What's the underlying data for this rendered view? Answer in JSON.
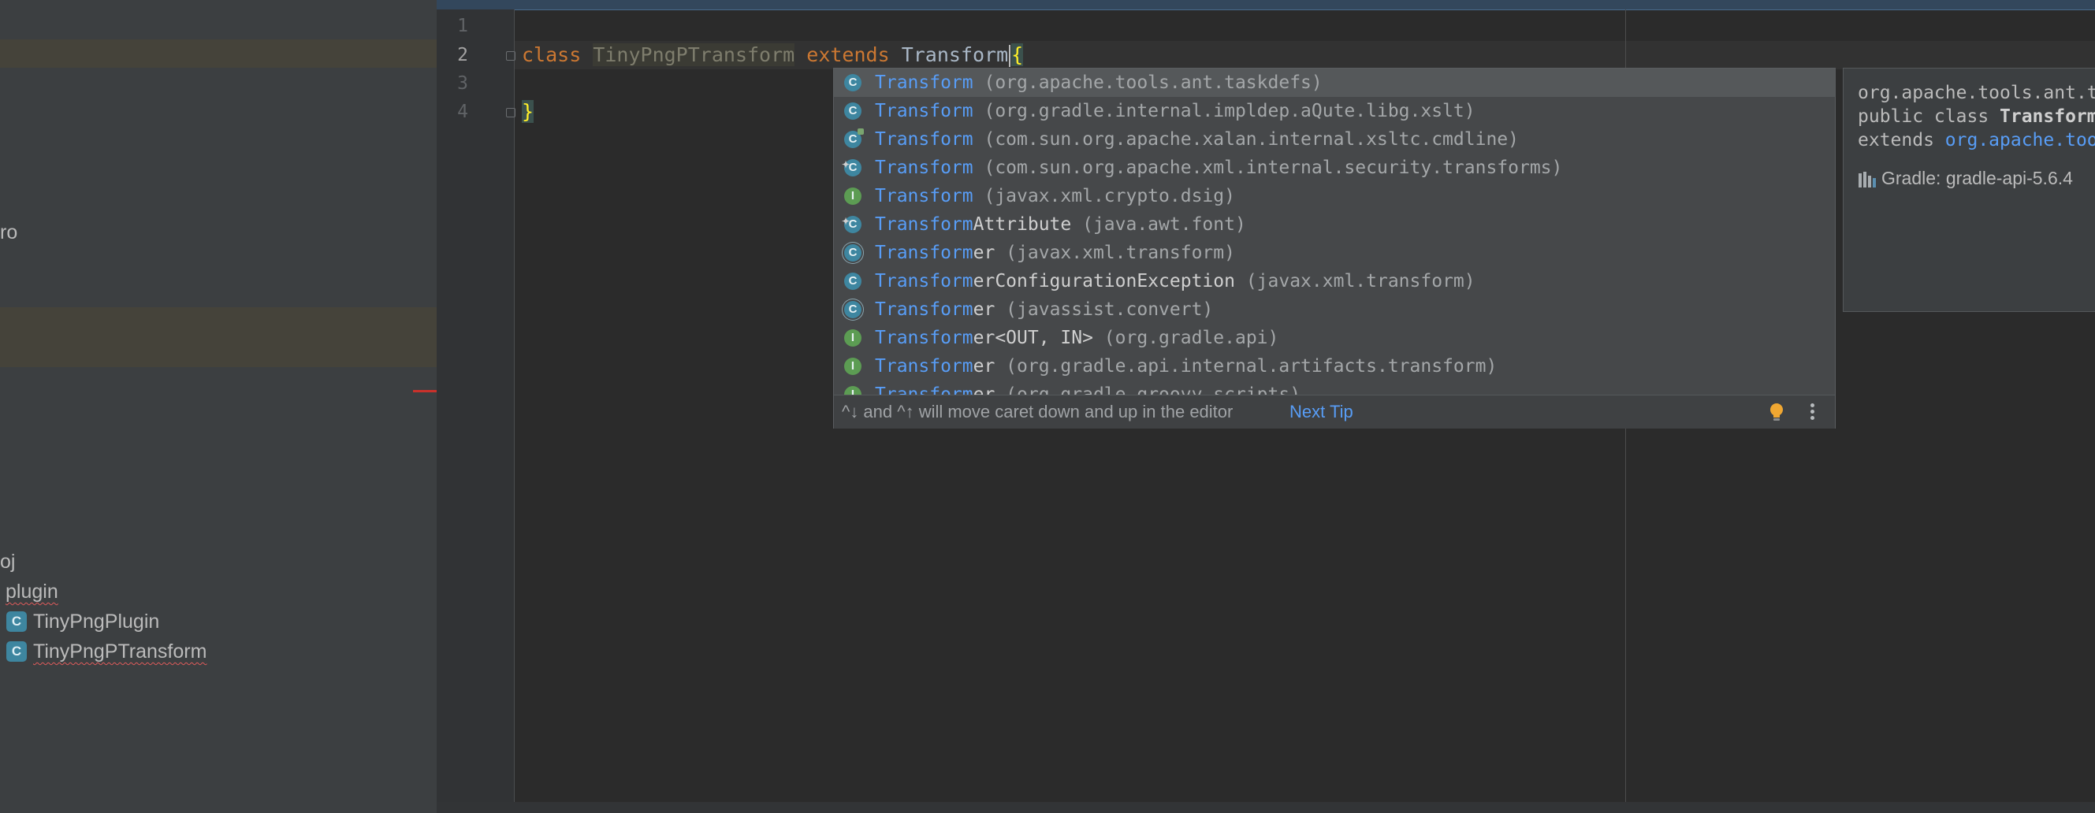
{
  "project_tree": {
    "partial_item_1": "ro",
    "partial_item_2": "oj",
    "folder_label": "plugin",
    "files": [
      {
        "badge": "C",
        "name": "TinyPngPlugin"
      },
      {
        "badge": "C",
        "name": "TinyPngPTransform"
      }
    ]
  },
  "editor": {
    "line_numbers": [
      "1",
      "2",
      "3",
      "4"
    ],
    "current_line": "2",
    "code": {
      "kw_class": "class",
      "class_name": "TinyPngPTransform",
      "kw_extends": "extends",
      "typed": "Transform",
      "open_brace": "{",
      "close_brace": "}"
    }
  },
  "completion": {
    "items": [
      {
        "icon": "class",
        "letter": "C",
        "match": "Transform",
        "rest": "",
        "qualifier": " (org.apache.tools.ant.taskdefs)",
        "selected": true
      },
      {
        "icon": "class",
        "letter": "C",
        "match": "Transform",
        "rest": "",
        "qualifier": " (org.gradle.internal.impldep.aQute.libg.xslt)",
        "selected": false
      },
      {
        "icon": "class-lib",
        "letter": "C",
        "match": "Transform",
        "rest": "",
        "qualifier": " (com.sun.org.apache.xalan.internal.xsltc.cmdline)",
        "selected": false
      },
      {
        "icon": "class-pin",
        "letter": "C",
        "match": "Transform",
        "rest": "",
        "qualifier": " (com.sun.org.apache.xml.internal.security.transforms)",
        "selected": false
      },
      {
        "icon": "interface",
        "letter": "I",
        "match": "Transform",
        "rest": "",
        "qualifier": " (javax.xml.crypto.dsig)",
        "selected": false
      },
      {
        "icon": "class-pin",
        "letter": "C",
        "match": "Transform",
        "rest": "Attribute",
        "qualifier": " (java.awt.font)",
        "selected": false
      },
      {
        "icon": "abstract",
        "letter": "C",
        "match": "Transform",
        "rest": "er",
        "qualifier": " (javax.xml.transform)",
        "selected": false
      },
      {
        "icon": "class",
        "letter": "C",
        "match": "Transform",
        "rest": "erConfigurationException",
        "qualifier": " (javax.xml.transform)",
        "selected": false
      },
      {
        "icon": "abstract",
        "letter": "C",
        "match": "Transform",
        "rest": "er",
        "qualifier": " (javassist.convert)",
        "selected": false
      },
      {
        "icon": "interface",
        "letter": "I",
        "match": "Transform",
        "rest": "er<OUT, IN>",
        "qualifier": " (org.gradle.api)",
        "selected": false
      },
      {
        "icon": "interface",
        "letter": "I",
        "match": "Transform",
        "rest": "er",
        "qualifier": " (org.gradle.api.internal.artifacts.transform)",
        "selected": false
      },
      {
        "icon": "interface",
        "letter": "I",
        "match": "Transform",
        "rest": "er",
        "qualifier": " (org.gradle.groovy.scripts)",
        "selected": false
      }
    ],
    "footer": {
      "tip": "^↓ and ^↑ will move caret down and up in the editor",
      "next_tip": "Next Tip"
    }
  },
  "doc_popup": {
    "package_line": "org.apache.tools.ant.taskdefs",
    "decl_prefix": "public class ",
    "decl_class": "Transform",
    "extends_prefix": "extends ",
    "extends_link": "org.apache.tools.ant.taskdefs.XSLTProcess",
    "library": "Gradle: gradle-api-5.6.4"
  },
  "colors": {
    "match": "#589df6",
    "keyword": "#cc7832",
    "class_icon": "#3e86a0",
    "interface_icon": "#5c9c53"
  }
}
